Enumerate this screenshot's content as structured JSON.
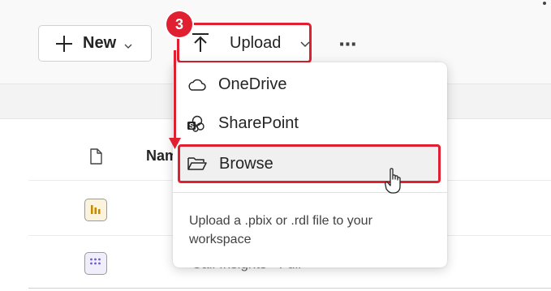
{
  "toolbar": {
    "new_label": "New",
    "upload_label": "Upload",
    "more_label": "⋯",
    "step_number": "3"
  },
  "table": {
    "header_name": "Nam",
    "rows": [
      {
        "name": "",
        "type_icon": "report-icon"
      },
      {
        "name": "Call Insights - Full",
        "type_icon": "dashboard-icon"
      }
    ]
  },
  "upload_menu": {
    "items": [
      {
        "label": "OneDrive",
        "icon": "cloud-icon"
      },
      {
        "label": "SharePoint",
        "icon": "sharepoint-icon"
      },
      {
        "label": "Browse",
        "icon": "folder-open-icon"
      }
    ],
    "hint": "Upload a .pbix or .rdl file to your workspace"
  },
  "colors": {
    "highlight": "#e02030",
    "report_accent": "#c58a00",
    "dashboard_accent": "#6b5cc7"
  }
}
